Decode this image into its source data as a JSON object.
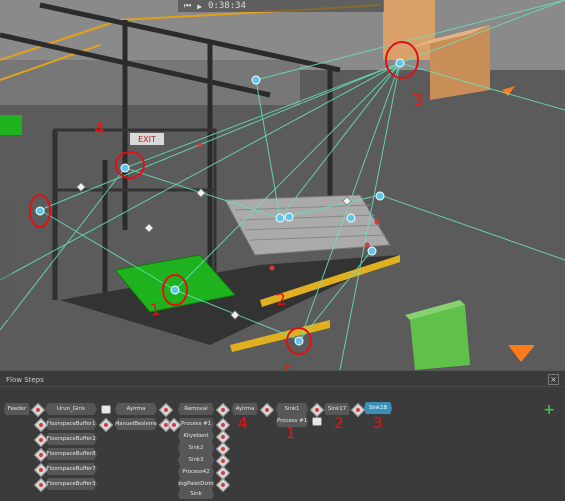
{
  "viewport": {
    "timer": "0:38:34",
    "exit_sign": "EXIT"
  },
  "annotations": {
    "labels": [
      "4",
      "3",
      "1",
      "2",
      "5"
    ]
  },
  "panel": {
    "title": "Flow Steps",
    "close": "×",
    "add": "+"
  },
  "steps": {
    "feeder": "Feeder",
    "col2": [
      "Urun_Giris",
      "FloorspaceBuffer1",
      "FloorspaceBuffer2",
      "FloorspaceBuffer8",
      "FloorspaceBuffer7",
      "FloorspaceBuffer3"
    ],
    "col3": [
      "Ayirma",
      "ManuelBesleme"
    ],
    "col4": [
      "Removal",
      "Process #1",
      "Kliyebent",
      "Sink2",
      "Sink3",
      "Process42",
      "BogPaletDizim",
      "Sink"
    ],
    "col5": [
      "Ayirma"
    ],
    "col6": [
      "Sink1",
      "Process #1"
    ],
    "col7": [
      "Sink17"
    ],
    "col8": [
      "Sink18"
    ]
  },
  "panel_annotations": [
    "4",
    "1",
    "2",
    "3"
  ],
  "colors": {
    "accent": "#3a8fb7",
    "annotation": "#e11111",
    "add": "#3fbf3f",
    "pallet": "#1fb21f",
    "line": "#67e3b8"
  }
}
